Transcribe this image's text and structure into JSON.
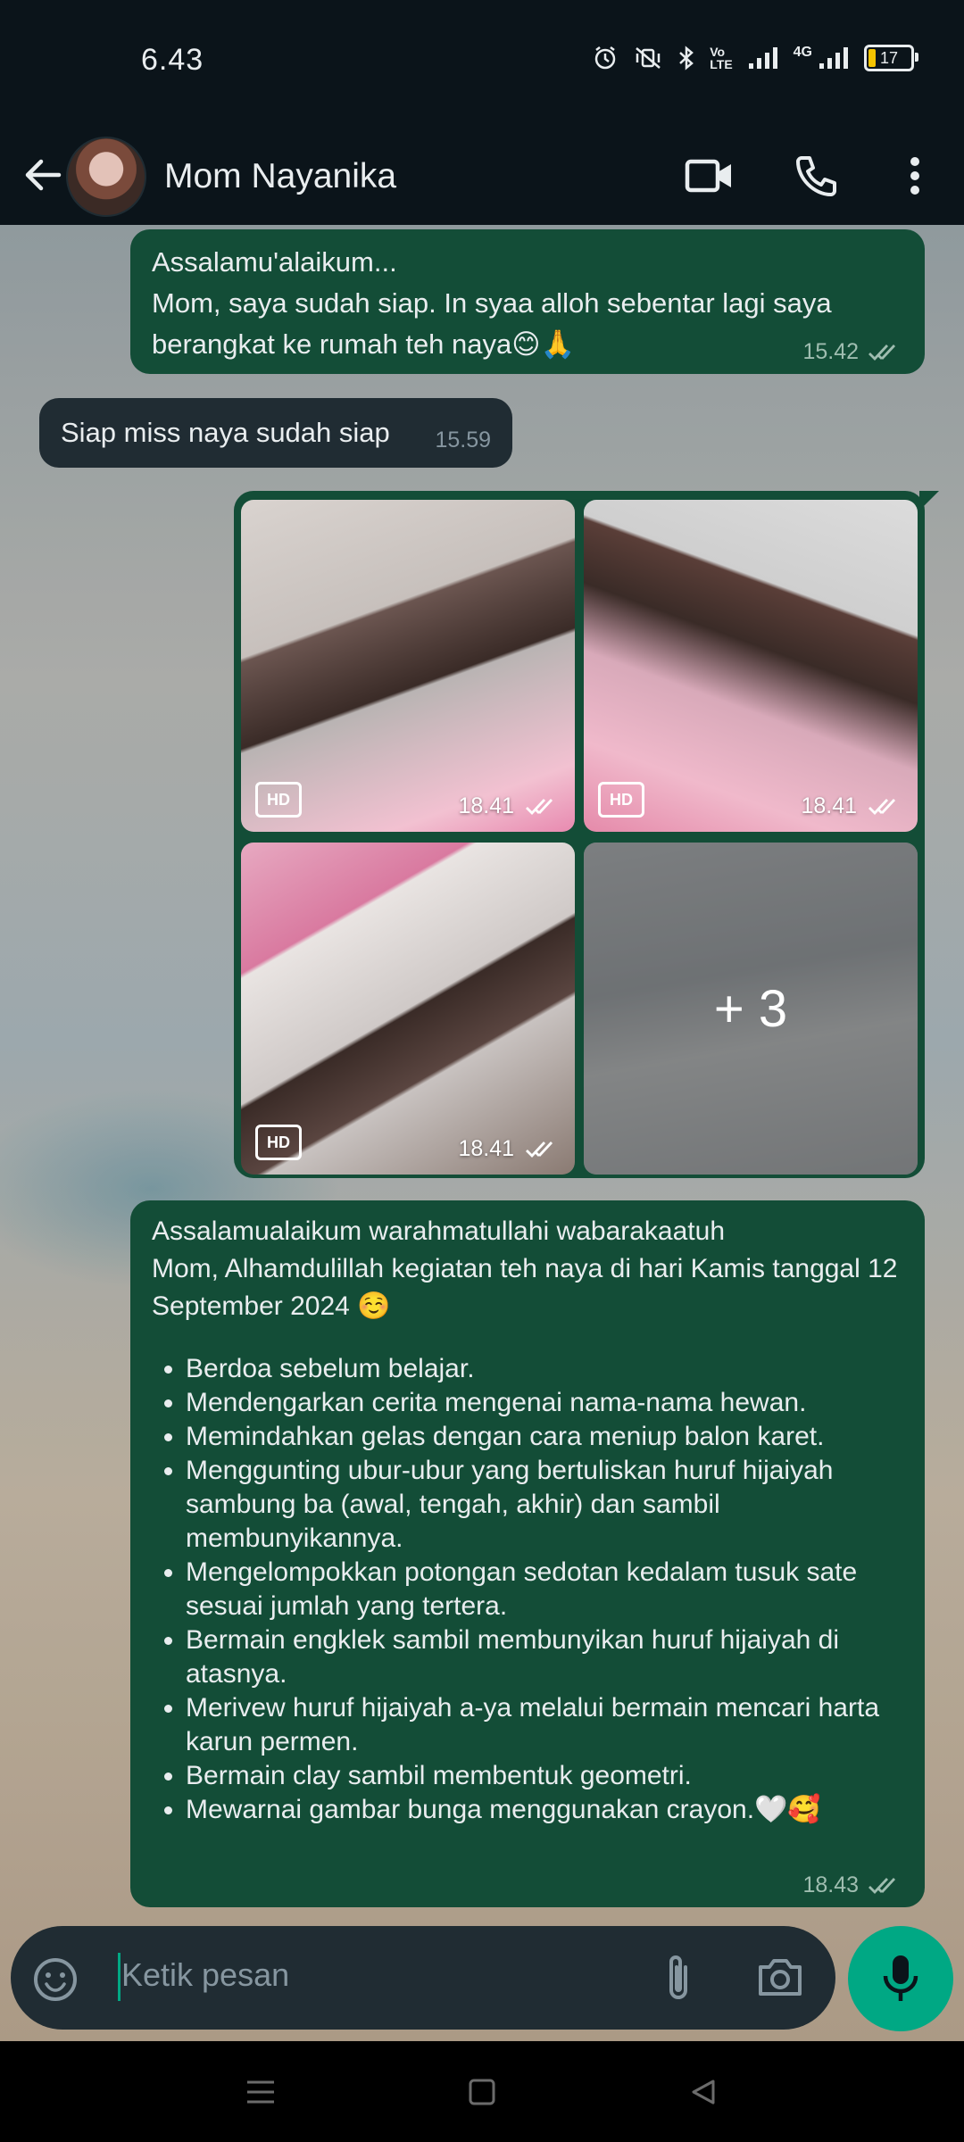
{
  "status_bar": {
    "time": "6.43",
    "volte": "Vo\nLTE",
    "network": "4G",
    "battery": "17"
  },
  "header": {
    "contact_name": "Mom Nayanika"
  },
  "messages": [
    {
      "direction": "outgoing",
      "text": "Assalamu'alaikum...\nMom, saya sudah siap. In syaa alloh sebentar lagi saya berangkat ke rumah teh naya😊🙏",
      "time": "15.42",
      "status": "read"
    },
    {
      "direction": "incoming",
      "text": "Siap miss naya sudah siap",
      "time": "15.59"
    },
    {
      "direction": "outgoing",
      "type": "photo_album",
      "photos": [
        {
          "badge": "HD",
          "time": "18.41",
          "status": "read"
        },
        {
          "badge": "HD",
          "time": "18.41",
          "status": "read"
        },
        {
          "badge": "HD",
          "time": "18.41",
          "status": "read"
        },
        {
          "overlay": "+ 3"
        }
      ]
    },
    {
      "direction": "outgoing",
      "intro": "Assalamualaikum warahmatullahi wabarakaatuh\nMom, Alhamdulillah kegiatan teh naya di hari Kamis tanggal 12 September 2024 ☺️",
      "items": [
        "Berdoa sebelum belajar.",
        "Mendengarkan cerita mengenai nama-nama hewan.",
        "Memindahkan gelas dengan cara meniup balon karet.",
        "Menggunting ubur-ubur yang bertuliskan huruf hijaiyah sambung ba (awal, tengah, akhir) dan sambil membunyikannya.",
        "Mengelompokkan potongan sedotan kedalam tusuk sate sesuai jumlah yang tertera.",
        "Bermain engklek sambil membunyikan huruf hijaiyah di atasnya.",
        "Merivew huruf hijaiyah a-ya melalui bermain mencari harta karun permen.",
        "Bermain clay sambil membentuk geometri.",
        "Mewarnai gambar bunga menggunakan crayon.🤍🥰"
      ],
      "time": "18.43",
      "status": "read"
    }
  ],
  "composer": {
    "placeholder": "Ketik pesan"
  },
  "colors": {
    "outgoing_bubble": "#134d37",
    "incoming_bubble": "#202c33",
    "accent": "#00a884",
    "bar": "#0b141a"
  }
}
